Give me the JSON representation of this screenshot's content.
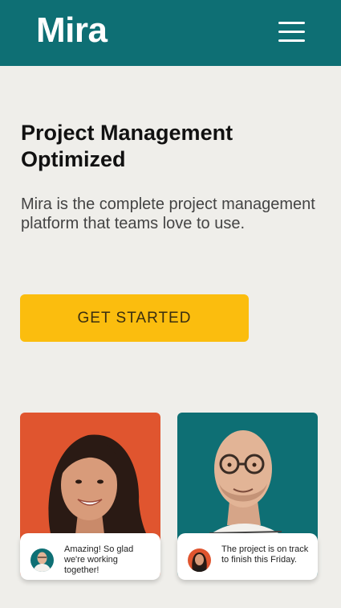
{
  "header": {
    "logo": "Mira",
    "menu_icon": "hamburger-menu-icon",
    "background": "#0e6f74"
  },
  "hero": {
    "title": "Project Management Optimized",
    "subtitle": "Mira is the complete project management platform that teams love to use.",
    "cta_label": "GET STARTED",
    "cta_color": "#fbbd0e"
  },
  "testimonials": [
    {
      "card_color": "#e0552f",
      "quote": "Amazing! So glad we're working together!",
      "avatar": "man-with-glasses-avatar"
    },
    {
      "card_color": "#0e6f74",
      "quote": "The project is on track to finish this Friday.",
      "avatar": "woman-dark-hair-avatar"
    }
  ]
}
